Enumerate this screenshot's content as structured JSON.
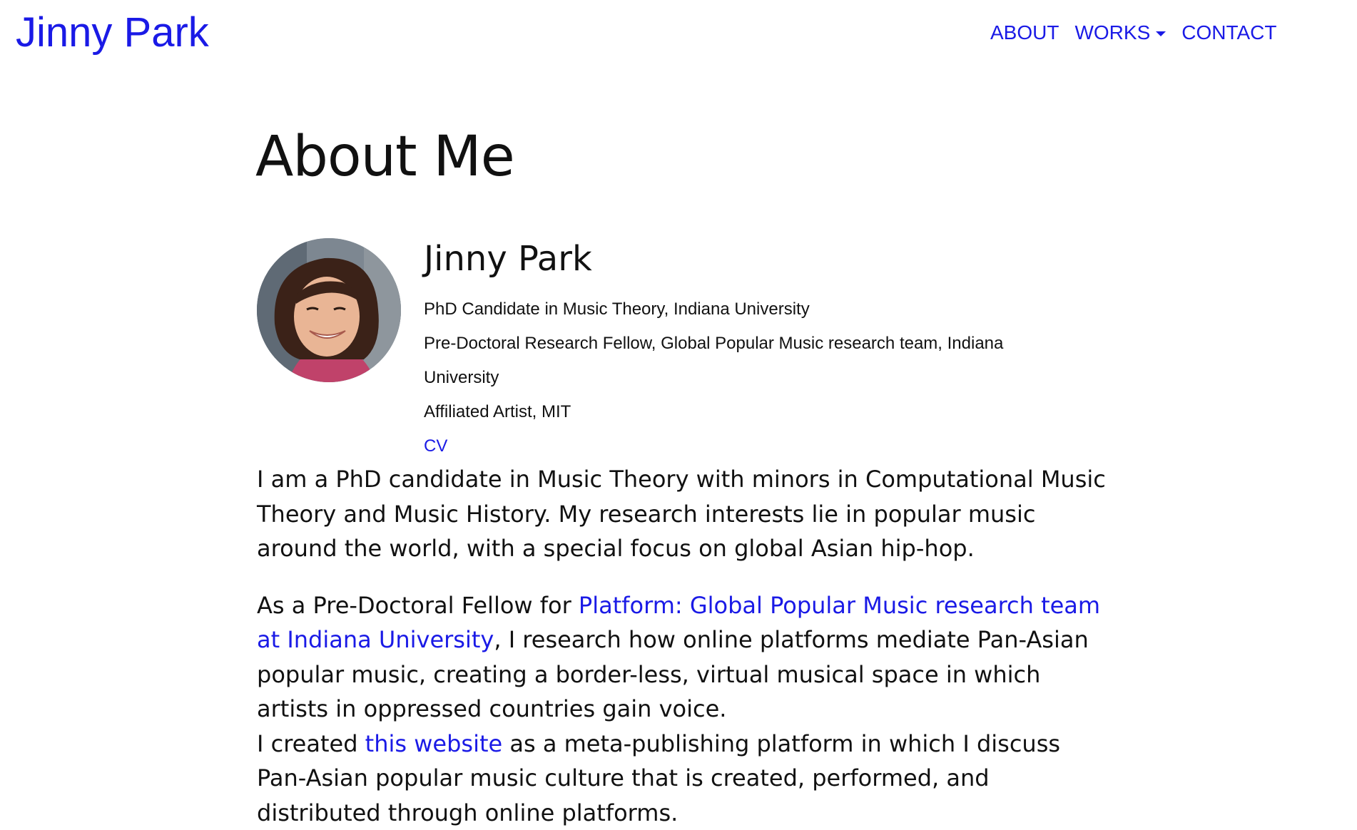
{
  "header": {
    "brand": "Jinny Park",
    "nav": [
      {
        "label": "ABOUT"
      },
      {
        "label": "WORKS"
      },
      {
        "label": "CONTACT"
      }
    ]
  },
  "main": {
    "title": "About Me",
    "profile": {
      "name": "Jinny Park",
      "lines": [
        "PhD Candidate in Music Theory, Indiana University",
        "Pre-Doctoral Research Fellow, Global Popular Music research team, Indiana University",
        "Affiliated Artist, MIT"
      ],
      "cv_link": "CV"
    },
    "bio": {
      "p1": "I am a PhD candidate in Music Theory with minors in Computational Music Theory and Music History. My research interests lie in popular music around the world, with a special focus on global Asian hip-hop.",
      "p2_before": "As a Pre-Doctoral Fellow for ",
      "p2_link": "Platform: Global Popular Music research team at Indiana University",
      "p2_after": ", I research how online platforms mediate Pan-Asian popular music, creating a border-less, virtual musical space in which artists in oppressed countries gain voice.",
      "p3_before": "I created ",
      "p3_link": "this website",
      "p3_after": " as a meta-publishing platform in which I discuss Pan-Asian popular music culture that is created, performed, and distributed through online platforms."
    }
  },
  "colors": {
    "link": "#1a1ae6",
    "text": "#111111"
  }
}
